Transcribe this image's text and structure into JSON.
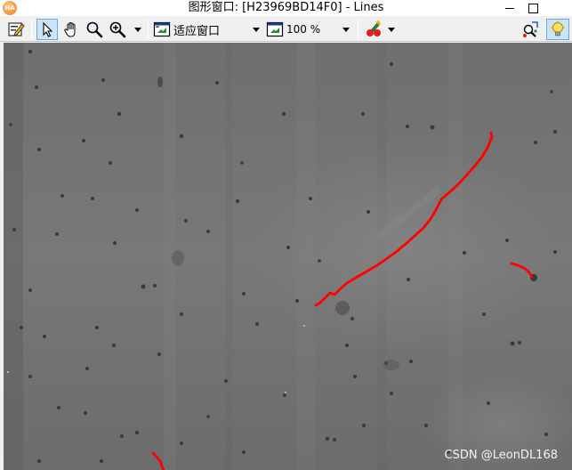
{
  "window": {
    "title": "图形窗口: [H23969BD14F0] - Lines",
    "app_icon_text": "HA"
  },
  "toolbar": {
    "display_mode_label": "适应窗口",
    "zoom_value": "100 %",
    "icons": [
      "edit-icon",
      "pointer-icon",
      "hand-icon",
      "magnify-icon",
      "zoom-in-icon",
      "fit-window-icon",
      "zoom-icon",
      "color-pick-icon",
      "region-icon",
      "lightbulb-icon"
    ]
  },
  "image": {
    "watermark": "CSDN @LeonDL168",
    "line_color": "#ff0000",
    "background_color": "#7a7a7a"
  }
}
